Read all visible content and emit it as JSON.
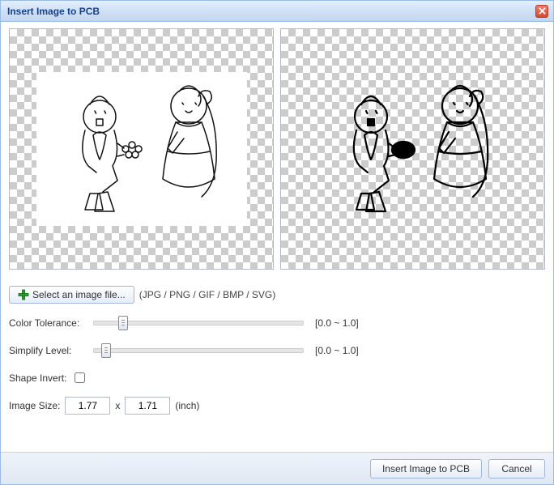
{
  "dialog": {
    "title": "Insert Image to PCB"
  },
  "select_button": {
    "label": "Select an image file..."
  },
  "file_hint": "(JPG / PNG / GIF / BMP / SVG)",
  "color_tolerance": {
    "label": "Color Tolerance:",
    "range": "[0.0 ~ 1.0]",
    "position_percent": 12
  },
  "simplify_level": {
    "label": "Simplify Level:",
    "range": "[0.0 ~ 1.0]",
    "position_percent": 4
  },
  "shape_invert": {
    "label": "Shape Invert:",
    "checked": false
  },
  "image_size": {
    "label": "Image Size:",
    "width": "1.77",
    "height": "1.71",
    "separator": "x",
    "unit": "(inch)"
  },
  "footer": {
    "primary": "Insert Image to PCB",
    "cancel": "Cancel"
  }
}
